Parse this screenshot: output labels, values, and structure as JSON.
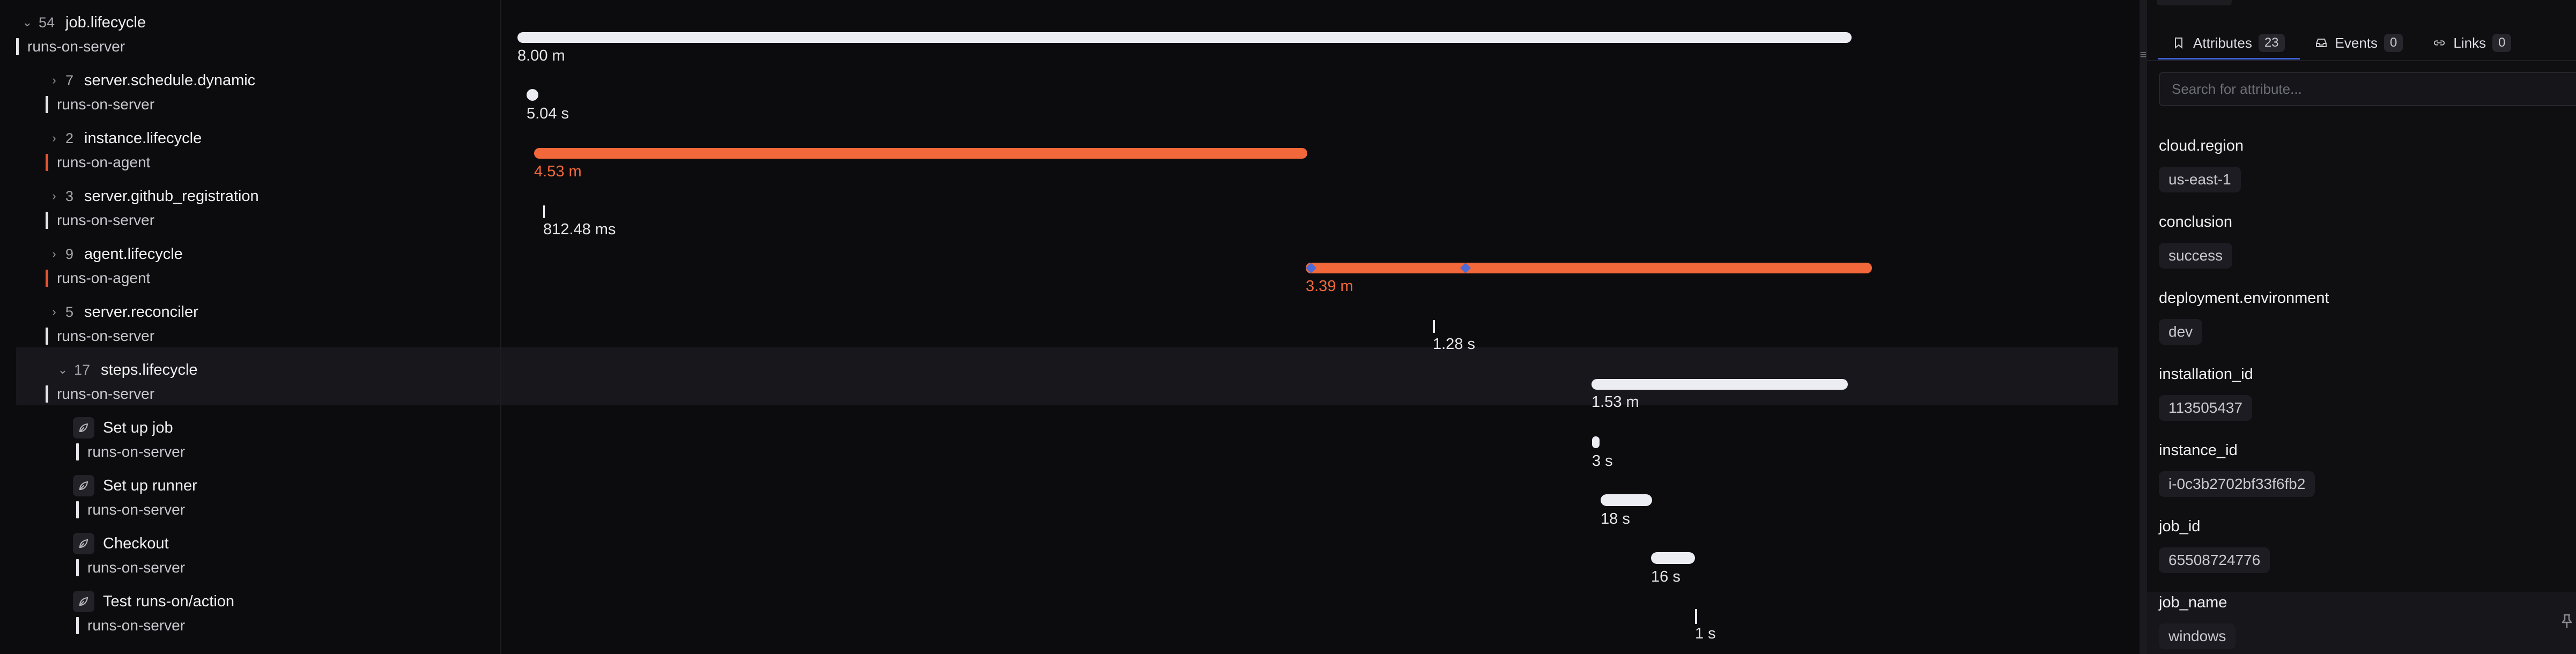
{
  "tree": {
    "rows": [
      {
        "name": "job.lifecycle",
        "count": "54",
        "expanded": true,
        "service": "runs-on-server",
        "color": "white"
      },
      {
        "name": "server.schedule.dynamic",
        "count": "7",
        "expanded": false,
        "service": "runs-on-server",
        "color": "white"
      },
      {
        "name": "instance.lifecycle",
        "count": "2",
        "expanded": false,
        "service": "runs-on-agent",
        "color": "red"
      },
      {
        "name": "server.github_registration",
        "count": "3",
        "expanded": false,
        "service": "runs-on-server",
        "color": "white"
      },
      {
        "name": "agent.lifecycle",
        "count": "9",
        "expanded": false,
        "service": "runs-on-agent",
        "color": "red"
      },
      {
        "name": "server.reconciler",
        "count": "5",
        "expanded": false,
        "service": "runs-on-server",
        "color": "white"
      },
      {
        "name": "steps.lifecycle",
        "count": "17",
        "expanded": true,
        "service": "runs-on-server",
        "color": "white",
        "selected": true
      },
      {
        "name": "Set up job",
        "leaf": true,
        "service": "runs-on-server",
        "color": "white"
      },
      {
        "name": "Set up runner",
        "leaf": true,
        "service": "runs-on-server",
        "color": "white"
      },
      {
        "name": "Checkout",
        "leaf": true,
        "service": "runs-on-server",
        "color": "white"
      },
      {
        "name": "Test runs-on/action",
        "leaf": true,
        "service": "runs-on-server",
        "color": "white"
      }
    ]
  },
  "timeline": {
    "spans": [
      {
        "duration": "8.00 m",
        "color": "white"
      },
      {
        "duration": "5.04 s",
        "color": "white"
      },
      {
        "duration": "4.53 m",
        "color": "red"
      },
      {
        "duration": "812.48 ms",
        "color": "white"
      },
      {
        "duration": "3.39 m",
        "color": "red"
      },
      {
        "duration": "1.28 s",
        "color": "white"
      },
      {
        "duration": "1.53 m",
        "color": "white"
      },
      {
        "duration": "3 s",
        "color": "white"
      },
      {
        "duration": "18 s",
        "color": "white"
      },
      {
        "duration": "16 s",
        "color": "white"
      },
      {
        "duration": "1 s",
        "color": "white"
      }
    ]
  },
  "panel": {
    "tabs": [
      {
        "label": "Attributes",
        "count": "23",
        "icon": "bookmark-icon",
        "active": true
      },
      {
        "label": "Events",
        "count": "0",
        "icon": "inbox-icon",
        "active": false
      },
      {
        "label": "Links",
        "count": "0",
        "icon": "link-icon",
        "active": false
      }
    ],
    "search_placeholder": "Search for attribute...",
    "attributes": [
      {
        "key": "cloud.region",
        "value": "us-east-1"
      },
      {
        "key": "conclusion",
        "value": "success"
      },
      {
        "key": "deployment.environment",
        "value": "dev"
      },
      {
        "key": "installation_id",
        "value": "113505437"
      },
      {
        "key": "instance_id",
        "value": "i-0c3b2702bf33f6fb2"
      },
      {
        "key": "job_id",
        "value": "65508724776"
      },
      {
        "key": "job_name",
        "value": "windows"
      }
    ]
  },
  "colors": {
    "accent": "#3e63d6",
    "agent_red": "#f2683a",
    "server_white": "#ececf3"
  }
}
